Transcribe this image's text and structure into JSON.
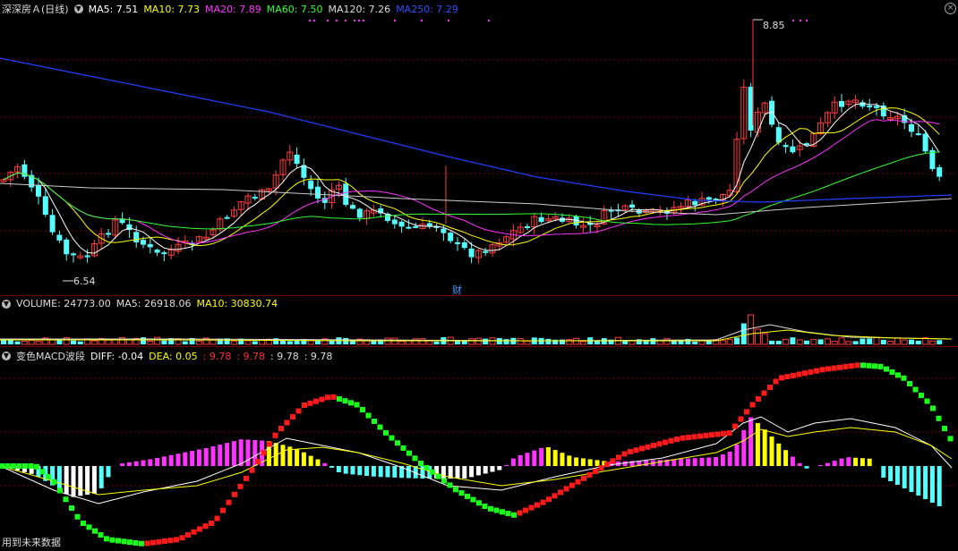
{
  "price_header": {
    "title": "深深房Ａ(日线)",
    "ma5": "MA5: 7.51",
    "ma10": "MA10: 7.73",
    "ma20": "MA20: 7.89",
    "ma60": "MA60: 7.50",
    "ma120": "MA120: 7.26",
    "ma250": "MA250: 7.29"
  },
  "price_annotations": {
    "high": "8.85",
    "low": "6.54",
    "event": "财"
  },
  "volume_header": {
    "volume": "VOLUME: 24773.00",
    "ma5": "MA5: 26918.06",
    "ma10": "MA10: 30830.74"
  },
  "macd_header": {
    "title": "变色MACD波段",
    "diff": "DIFF: -0.04",
    "dea": "DEA: 0.05",
    "v1": ": 9.78",
    "v2": ": 9.78",
    "v3": ": 9.78",
    "v4": ": 9.78"
  },
  "footer_note": "用到未来数据",
  "colors": {
    "up": "#ff3c3c",
    "down": "#54ffff",
    "ma5": "#ffffff",
    "ma10": "#ffff00",
    "ma20": "#ff32ff",
    "ma60": "#32ff32",
    "ma120": "#cccccc",
    "ma250": "#2040ff",
    "macd_pos_magenta": "#ff32ff",
    "macd_pos_yellow": "#ffff00",
    "macd_neg_cyan": "#54ffff",
    "macd_neg_white": "#ffffff",
    "wave_up": "#ff1a1a",
    "wave_down": "#1aff1a"
  }
}
